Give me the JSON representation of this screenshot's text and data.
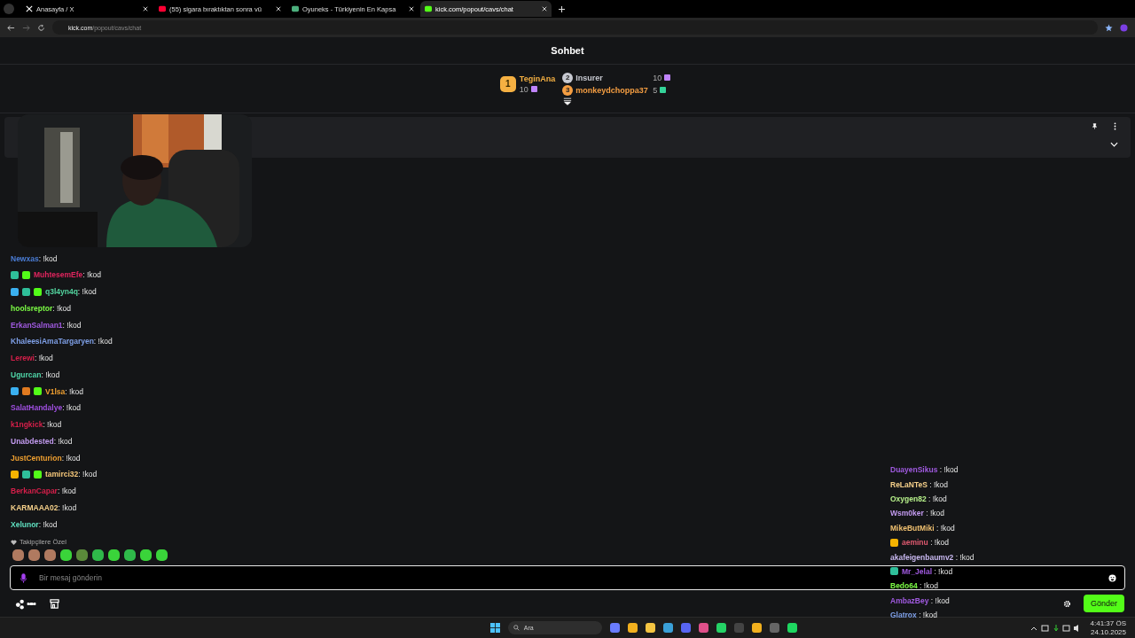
{
  "browser": {
    "tabs": [
      {
        "title": "Anasayfa / X",
        "kind": "x",
        "selected": false
      },
      {
        "title": "(55) sigara bıraktıktan sonra vü",
        "kind": "youtube",
        "selected": false
      },
      {
        "title": "Oyuneks - Türkiyenin En Kapsa",
        "kind": "oyuneks",
        "selected": false
      },
      {
        "title": "kick.com/popout/cavs/chat",
        "kind": "kick",
        "selected": true
      }
    ],
    "address": {
      "host": "kick.com",
      "path": "/popout/cavs/chat"
    }
  },
  "header": {
    "title": "Sohbet"
  },
  "leaderboard": [
    {
      "rank": "1",
      "name": "TeginAna",
      "count": "10",
      "color": "#f5b042",
      "gift": {
        "color": "#c084fc"
      }
    },
    {
      "rank": "2",
      "name": "Insurer",
      "count": "10",
      "color": "#c7c9d1",
      "gift": {
        "color": "#c084fc"
      }
    },
    {
      "rank": "3",
      "name": "monkeydchoppa37",
      "count": "5",
      "color": "#f59e42",
      "gift": {
        "color": "#34d399"
      }
    }
  ],
  "chat": [
    {
      "user": "Newxas",
      "color": "#4a7dd6",
      "text": ": !kod"
    },
    {
      "user": "MuhtesemEfe",
      "color": "#e0245e",
      "text": ": !kod",
      "badges": [
        {
          "kind": "boot"
        },
        {
          "kind": "gift"
        }
      ]
    },
    {
      "user": "q3l4yn4q",
      "color": "#53d6a0",
      "text": ": !kod",
      "badges": [
        {
          "kind": "hammer"
        },
        {
          "kind": "boot"
        },
        {
          "kind": "gift"
        }
      ]
    },
    {
      "user": "hoolsreptor",
      "color": "#7cfc45",
      "text": ": !kod"
    },
    {
      "user": "ErkanSalman1",
      "color": "#a05ae0",
      "text": ": !kod"
    },
    {
      "user": "KhaleesiAmaTargaryen",
      "color": "#7fa0e8",
      "text": ": !kod"
    },
    {
      "user": "Lerewi",
      "color": "#d61f4a",
      "text": ": !kod"
    },
    {
      "user": "Ugurcan",
      "color": "#4fd6a8",
      "text": ": !kod"
    },
    {
      "user": "V1lsa",
      "color": "#f0a030",
      "text": ": !kod",
      "badges": [
        {
          "kind": "hammer"
        },
        {
          "kind": "flame"
        },
        {
          "kind": "gift"
        }
      ]
    },
    {
      "user": "SalatHandalye",
      "color": "#9f4fe0",
      "text": ": !kod"
    },
    {
      "user": "k1ngkick",
      "color": "#d61f4a",
      "text": ": !kod"
    },
    {
      "user": "Unabdested",
      "color": "#c39bf0",
      "text": ": !kod"
    },
    {
      "user": "JustCenturion",
      "color": "#f0a030",
      "text": ": !kod"
    },
    {
      "user": "tamirci32",
      "color": "#f5c77a",
      "text": ": !kod",
      "badges": [
        {
          "kind": "coin"
        },
        {
          "kind": "boot"
        },
        {
          "kind": "gift"
        }
      ]
    },
    {
      "user": "BerkanCapar",
      "color": "#d61f4a",
      "text": ": !kod"
    },
    {
      "user": "KARMAAA02",
      "color": "#f5d08a",
      "text": ": !kod"
    },
    {
      "user": "Xelunor",
      "color": "#5fe0c0",
      "text": ": !kod"
    }
  ],
  "emotes": {
    "label": "Takipçilere Özel",
    "items": [
      {
        "kind": "face"
      },
      {
        "kind": "face"
      },
      {
        "kind": "face"
      },
      {
        "kind": "blob"
      },
      {
        "kind": "box"
      },
      {
        "kind": "headset"
      },
      {
        "kind": "blob"
      },
      {
        "kind": "headset"
      },
      {
        "kind": "blob"
      },
      {
        "kind": "blob"
      }
    ]
  },
  "input": {
    "placeholder": "Bir mesaj gönderin"
  },
  "send_button": "Gönder",
  "overlay_chat": [
    {
      "user": "DuayenSikus",
      "color": "#a05ae0",
      "text": ": !kod"
    },
    {
      "user": "ReLaNTeS",
      "color": "#f5d08a",
      "text": ": !kod"
    },
    {
      "user": "Oxygen82",
      "color": "#b6f08a",
      "text": ": !kod"
    },
    {
      "user": "Wsm0ker",
      "color": "#c39bf0",
      "text": ": !kod"
    },
    {
      "user": "MikeButMiki",
      "color": "#f0c070",
      "text": ": !kod"
    },
    {
      "user": "aeminu",
      "color": "#e05a70",
      "text": ": !kod",
      "badges": [
        {
          "kind": "coin"
        }
      ]
    },
    {
      "user": "akafeigenbaumv2",
      "color": "#c8b8f0",
      "text": ": !kod"
    },
    {
      "user": "Mr_Jelal",
      "color": "#a05ae0",
      "text": ": !kod",
      "badges": [
        {
          "kind": "boot"
        }
      ]
    },
    {
      "user": "Bedo64",
      "color": "#7cfc45",
      "text": ": !kod"
    },
    {
      "user": "AmbazBey",
      "color": "#a05ae0",
      "text": ": !kod"
    },
    {
      "user": "Glatrox",
      "color": "#7fa0e8",
      "text": ": !kod"
    }
  ],
  "taskbar": {
    "search": "Ara",
    "apps": [
      {
        "kind": "copilot"
      },
      {
        "kind": "chrome"
      },
      {
        "kind": "folder"
      },
      {
        "kind": "ccleaner"
      },
      {
        "kind": "discord"
      },
      {
        "kind": "snip"
      },
      {
        "kind": "whatsapp"
      },
      {
        "kind": "obs"
      },
      {
        "kind": "chrome"
      },
      {
        "kind": "cam"
      },
      {
        "kind": "spotify"
      }
    ],
    "time": "4:41:37 ÖS",
    "date": "24.10.2025"
  }
}
